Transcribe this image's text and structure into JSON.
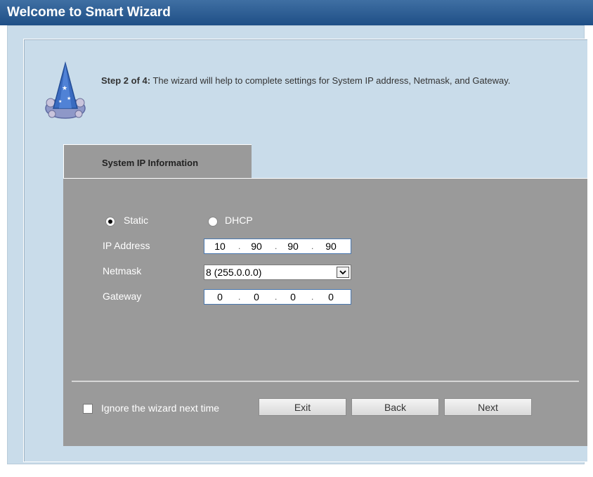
{
  "window": {
    "title": "Welcome to Smart Wizard"
  },
  "step": {
    "heading": "Step 2 of 4:",
    "text": " The wizard will help to complete settings for System IP address, Netmask, and Gateway."
  },
  "tab": {
    "label": "System IP Information"
  },
  "mode": {
    "static_label": "Static",
    "dhcp_label": "DHCP",
    "selected": "Static"
  },
  "fields": {
    "ip_label": "IP Address",
    "ip": [
      "10",
      "90",
      "90",
      "90"
    ],
    "netmask_label": "Netmask",
    "netmask_value": "8 (255.0.0.0)",
    "gateway_label": "Gateway",
    "gateway": [
      "0",
      "0",
      "0",
      "0"
    ],
    "separator": "."
  },
  "footer": {
    "ignore_label": "Ignore the wizard next time",
    "ignore_checked": false,
    "exit_label": "Exit",
    "back_label": "Back",
    "next_label": "Next"
  },
  "icons": {
    "wizard": "wizard-hat-icon",
    "netmask_dropdown": "chevron-down-icon"
  },
  "colors": {
    "title_bar": "#2b5c94",
    "background": "#c9dcea",
    "panel": "#9a9a9a"
  }
}
